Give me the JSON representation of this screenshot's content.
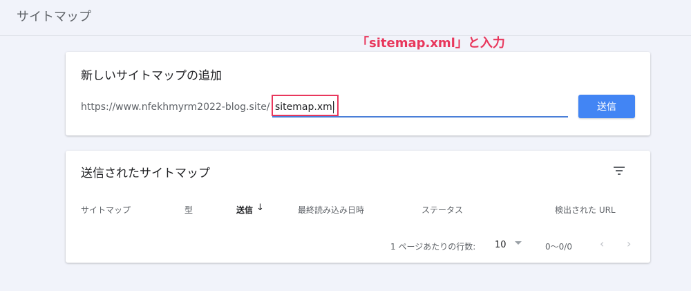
{
  "header": {
    "title": "サイトマップ"
  },
  "annotation": {
    "text": "「sitemap.xml」と入力",
    "color": "#e8375c"
  },
  "add_card": {
    "title": "新しいサイトマップの追加",
    "url_prefix": "https://www.nfekhmyrm2022-blog.site/",
    "input_value": "sitemap.xml",
    "submit_label": "送信",
    "accent": "#4285f4"
  },
  "submitted_card": {
    "title": "送信されたサイトマップ",
    "columns": [
      "サイトマップ",
      "型",
      "送信",
      "最終読み込み日時",
      "ステータス",
      "検出された URL"
    ],
    "sorted_column": "送信",
    "pagination": {
      "rows_per_page_label": "1 ページあたりの行数:",
      "rows_per_page": "10",
      "range": "0〜0/0"
    }
  }
}
